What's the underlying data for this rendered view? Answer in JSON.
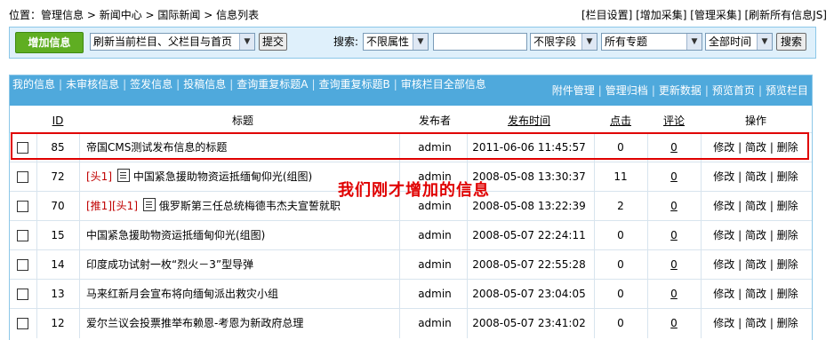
{
  "breadcrumb": {
    "prefix": "位置：",
    "items": [
      "管理信息",
      "新闻中心",
      "国际新闻",
      "信息列表"
    ],
    "sep": " > "
  },
  "top_links": "[栏目设置] [增加采集] [管理采集] [刷新所有信息JS]",
  "toolbar": {
    "add_label": "增加信息",
    "refresh_select": "刷新当前栏目、父栏目与首页",
    "submit_label": "提交",
    "search_label": "搜索:",
    "attr_select": "不限属性",
    "search_value": "",
    "field_select": "不限字段",
    "topic_select": "所有专题",
    "time_select": "全部时间",
    "search_button": "搜索"
  },
  "nav": {
    "left": [
      "我的信息",
      "未审核信息",
      "签发信息",
      "投稿信息",
      "查询重复标题A",
      "查询重复标题B",
      "审核栏目全部信息"
    ],
    "right": [
      "附件管理",
      "管理归档",
      "更新数据",
      "预览首页",
      "预览栏目"
    ]
  },
  "columns": {
    "id": "ID",
    "title": "标题",
    "publisher": "发布者",
    "time": "发布时间",
    "hits": "点击",
    "comments": "评论",
    "ops": "操作"
  },
  "ops": {
    "edit": "修改",
    "simple_edit": "简改",
    "delete": "删除"
  },
  "rows": [
    {
      "id": "85",
      "tags": "",
      "icon": false,
      "title": "帝国CMS测试发布信息的标题",
      "publisher": "admin",
      "time": "2011-06-06 11:45:57",
      "hits": "0",
      "comments": "0"
    },
    {
      "id": "72",
      "tags": "[头1]",
      "icon": true,
      "title": "中国紧急援助物资运抵缅甸仰光(组图)",
      "publisher": "admin",
      "time": "2008-05-08 13:30:37",
      "hits": "11",
      "comments": "0"
    },
    {
      "id": "70",
      "tags": "[推1][头1]",
      "icon": true,
      "title": "俄罗斯第三任总统梅德韦杰夫宣誓就职",
      "publisher": "admin",
      "time": "2008-05-08 13:22:39",
      "hits": "2",
      "comments": "0"
    },
    {
      "id": "15",
      "tags": "",
      "icon": false,
      "title": "中国紧急援助物资运抵缅甸仰光(组图)",
      "publisher": "admin",
      "time": "2008-05-07 22:24:11",
      "hits": "0",
      "comments": "0"
    },
    {
      "id": "14",
      "tags": "",
      "icon": false,
      "title": "印度成功试射一枚“烈火－3”型导弹",
      "publisher": "admin",
      "time": "2008-05-07 22:55:28",
      "hits": "0",
      "comments": "0"
    },
    {
      "id": "13",
      "tags": "",
      "icon": false,
      "title": "马来红新月会宣布将向缅甸派出救灾小组",
      "publisher": "admin",
      "time": "2008-05-07 23:04:05",
      "hits": "0",
      "comments": "0"
    },
    {
      "id": "12",
      "tags": "",
      "icon": false,
      "title": "爱尔兰议会投票推举布赖恩-考恩为新政府总理",
      "publisher": "admin",
      "time": "2008-05-07 23:41:02",
      "hits": "0",
      "comments": "0"
    }
  ],
  "annotation": "我们刚才增加的信息",
  "colors": {
    "nav_bg": "#4fa9dc",
    "toolbar_bg": "#dff0fb",
    "add_button": "#5fae22",
    "highlight": "#e00000",
    "tag": "#c00000"
  }
}
